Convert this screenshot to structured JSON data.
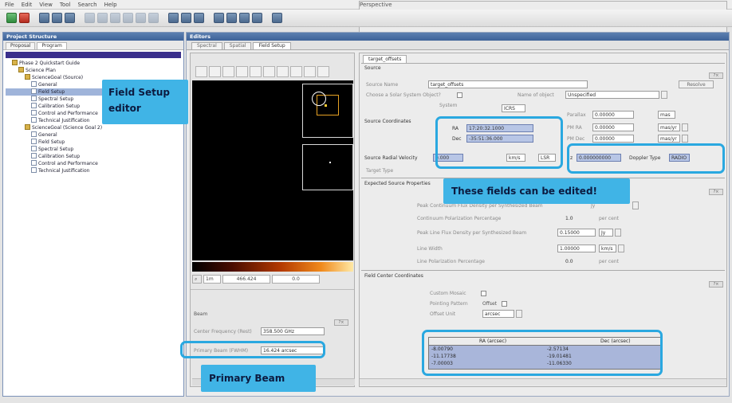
{
  "menu": {
    "items": [
      "File",
      "Edit",
      "View",
      "Tool",
      "Search",
      "Help"
    ],
    "right_label": "Perspective"
  },
  "left_pane": {
    "title": "Project Structure",
    "tabs": [
      "Proposal",
      "Program"
    ],
    "tree": [
      {
        "label": "Phase 2 Quickstart Guide",
        "indent": 1,
        "icon": "folder"
      },
      {
        "label": "Science Plan",
        "indent": 2,
        "icon": "folder"
      },
      {
        "label": "ScienceGoal (Source)",
        "indent": 3,
        "icon": "folder"
      },
      {
        "label": "General",
        "indent": 4,
        "icon": "doc"
      },
      {
        "label": "Field Setup",
        "indent": 4,
        "icon": "doc",
        "selected": true
      },
      {
        "label": "Spectral Setup",
        "indent": 4,
        "icon": "doc"
      },
      {
        "label": "Calibration Setup",
        "indent": 4,
        "icon": "doc"
      },
      {
        "label": "Control and Performance",
        "indent": 4,
        "icon": "doc"
      },
      {
        "label": "Technical Justification",
        "indent": 4,
        "icon": "doc"
      },
      {
        "label": "ScienceGoal (Science Goal 2)",
        "indent": 3,
        "icon": "folder"
      },
      {
        "label": "General",
        "indent": 4,
        "icon": "doc"
      },
      {
        "label": "Field Setup",
        "indent": 4,
        "icon": "doc"
      },
      {
        "label": "Spectral Setup",
        "indent": 4,
        "icon": "doc"
      },
      {
        "label": "Calibration Setup",
        "indent": 4,
        "icon": "doc"
      },
      {
        "label": "Control and Performance",
        "indent": 4,
        "icon": "doc"
      },
      {
        "label": "Technical Justification",
        "indent": 4,
        "icon": "doc"
      }
    ]
  },
  "editor": {
    "title": "Editors",
    "tabs": [
      "Spectral",
      "Spatial",
      "Field Setup"
    ]
  },
  "viewer": {
    "coord_a": "1m",
    "coord_b": "466.424",
    "coord_c": "0.0",
    "section_label": "Beam",
    "freq_label": "Center Frequency (Rest)",
    "freq_value": "358.500 GHz",
    "pb_label": "Primary Beam (FWHM)",
    "pb_value": "16.424 arcsec"
  },
  "source": {
    "tab_label": "target_offsets",
    "section": "Source",
    "name_label": "Source Name",
    "name_value": "target_offsets",
    "resolve_button": "Resolve",
    "solar_label": "Choose a Solar System Object?",
    "sso_label": "Name of object",
    "sso_value": "Unspecified",
    "coords_label": "Source Coordinates",
    "system_label": "System",
    "system_value": "ICRS",
    "ra_label": "RA",
    "ra_value": "17:20:32.1000",
    "dec_label": "Dec",
    "dec_value": "-35:51:36.000",
    "parallax_label": "Parallax",
    "parallax_value": "0.00000",
    "parallax_unit": "mas",
    "pmra_label": "PM RA",
    "pmra_value": "0.00000",
    "pmra_unit": "mas/yr",
    "pmdec_label": "PM Dec",
    "pmdec_value": "0.00000",
    "pmdec_unit": "mas/yr",
    "vel_label": "Source Radial Velocity",
    "vel_value": "0.000",
    "vel_unit": "km/s",
    "vel_frame": "LSR",
    "z_label": "z",
    "z_value": "0.000000000",
    "doppler_label": "Doppler Type",
    "doppler_value": "RADIO",
    "target_label": "Target Type"
  },
  "props": {
    "section": "Expected Source Properties",
    "rows": [
      {
        "label": "Peak Continuum Flux Density per Synthesized Beam",
        "value": "",
        "unit": "Jy"
      },
      {
        "label": "Continuum Polarization Percentage",
        "value": "1.0",
        "unit": "per cent"
      },
      {
        "label": "Peak Line Flux Density per Synthesized Beam",
        "value": "0.15000",
        "unit": "Jy"
      },
      {
        "label": "Line Width",
        "value": "1.00000",
        "unit": "km/s"
      },
      {
        "label": "Line Polarization Percentage",
        "value": "0.0",
        "unit": "per cent"
      }
    ]
  },
  "field_center": {
    "section": "Field Center Coordinates",
    "mosaic_label": "Custom Mosaic",
    "pattern_label": "Pointing Pattern",
    "pattern_value": "Offset",
    "offset_unit_label": "Offset Unit",
    "offset_unit_value": "arcsec",
    "columns": [
      "RA (arcsec)",
      "Dec (arcsec)"
    ],
    "rows": [
      [
        "-8.00790",
        "-2.57134"
      ],
      [
        "-11.17738",
        "-19.01481"
      ],
      [
        "-7.00003",
        "-11.06330"
      ]
    ]
  },
  "callouts": {
    "field_setup": "Field Setup editor",
    "editable": "These fields can be edited!",
    "primary_beam": "Primary Beam"
  },
  "colors": {
    "highlight": "#2aa8e0",
    "callout_bg": "#40b4e6",
    "selection": "#9fb4da"
  }
}
